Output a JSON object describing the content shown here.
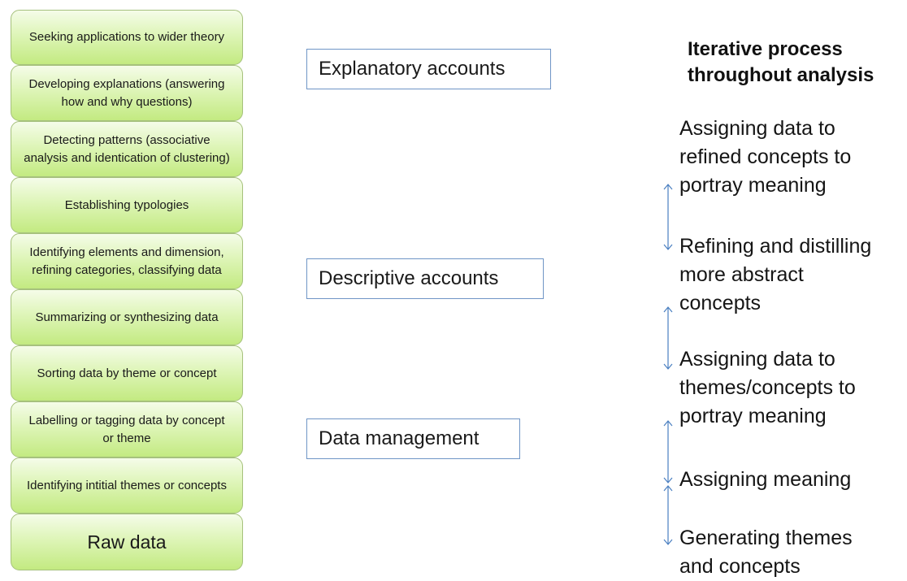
{
  "stack": [
    {
      "label": "Seeking applications to wider theory"
    },
    {
      "label": "Developing explanations (answering how and why questions)"
    },
    {
      "label": "Detecting patterns (associative analysis and identication of clustering)"
    },
    {
      "label": "Establishing typologies"
    },
    {
      "label": "Identifying elements and dimension, refining categories, classifying data"
    },
    {
      "label": "Summarizing or synthesizing data"
    },
    {
      "label": "Sorting data by theme or concept"
    },
    {
      "label": "Labelling or tagging data by concept or theme"
    },
    {
      "label": "Identifying intitial themes or concepts"
    },
    {
      "label": "Raw data"
    }
  ],
  "accounts": {
    "explanatory": "Explanatory accounts",
    "descriptive": "Descriptive accounts",
    "management": "Data management"
  },
  "iterative": {
    "title_line1": "Iterative process",
    "title_line2": "throughout analysis",
    "steps": [
      {
        "lines": [
          "Assigning data to",
          "refined concepts to",
          "portray meaning"
        ]
      },
      {
        "lines": [
          "Refining and distilling",
          "more abstract",
          "concepts"
        ]
      },
      {
        "lines": [
          "Assigning data to",
          "themes/concepts to",
          "portray meaning"
        ]
      },
      {
        "lines": [
          "Assigning meaning"
        ]
      },
      {
        "lines": [
          "Generating themes",
          "and concepts"
        ]
      }
    ]
  },
  "colors": {
    "box_fill_top": "#f5fce9",
    "box_fill_bottom": "#c3ea81",
    "box_border": "#a6c17d",
    "account_border": "#6f95c6",
    "arrow": "#4a7fc0"
  }
}
